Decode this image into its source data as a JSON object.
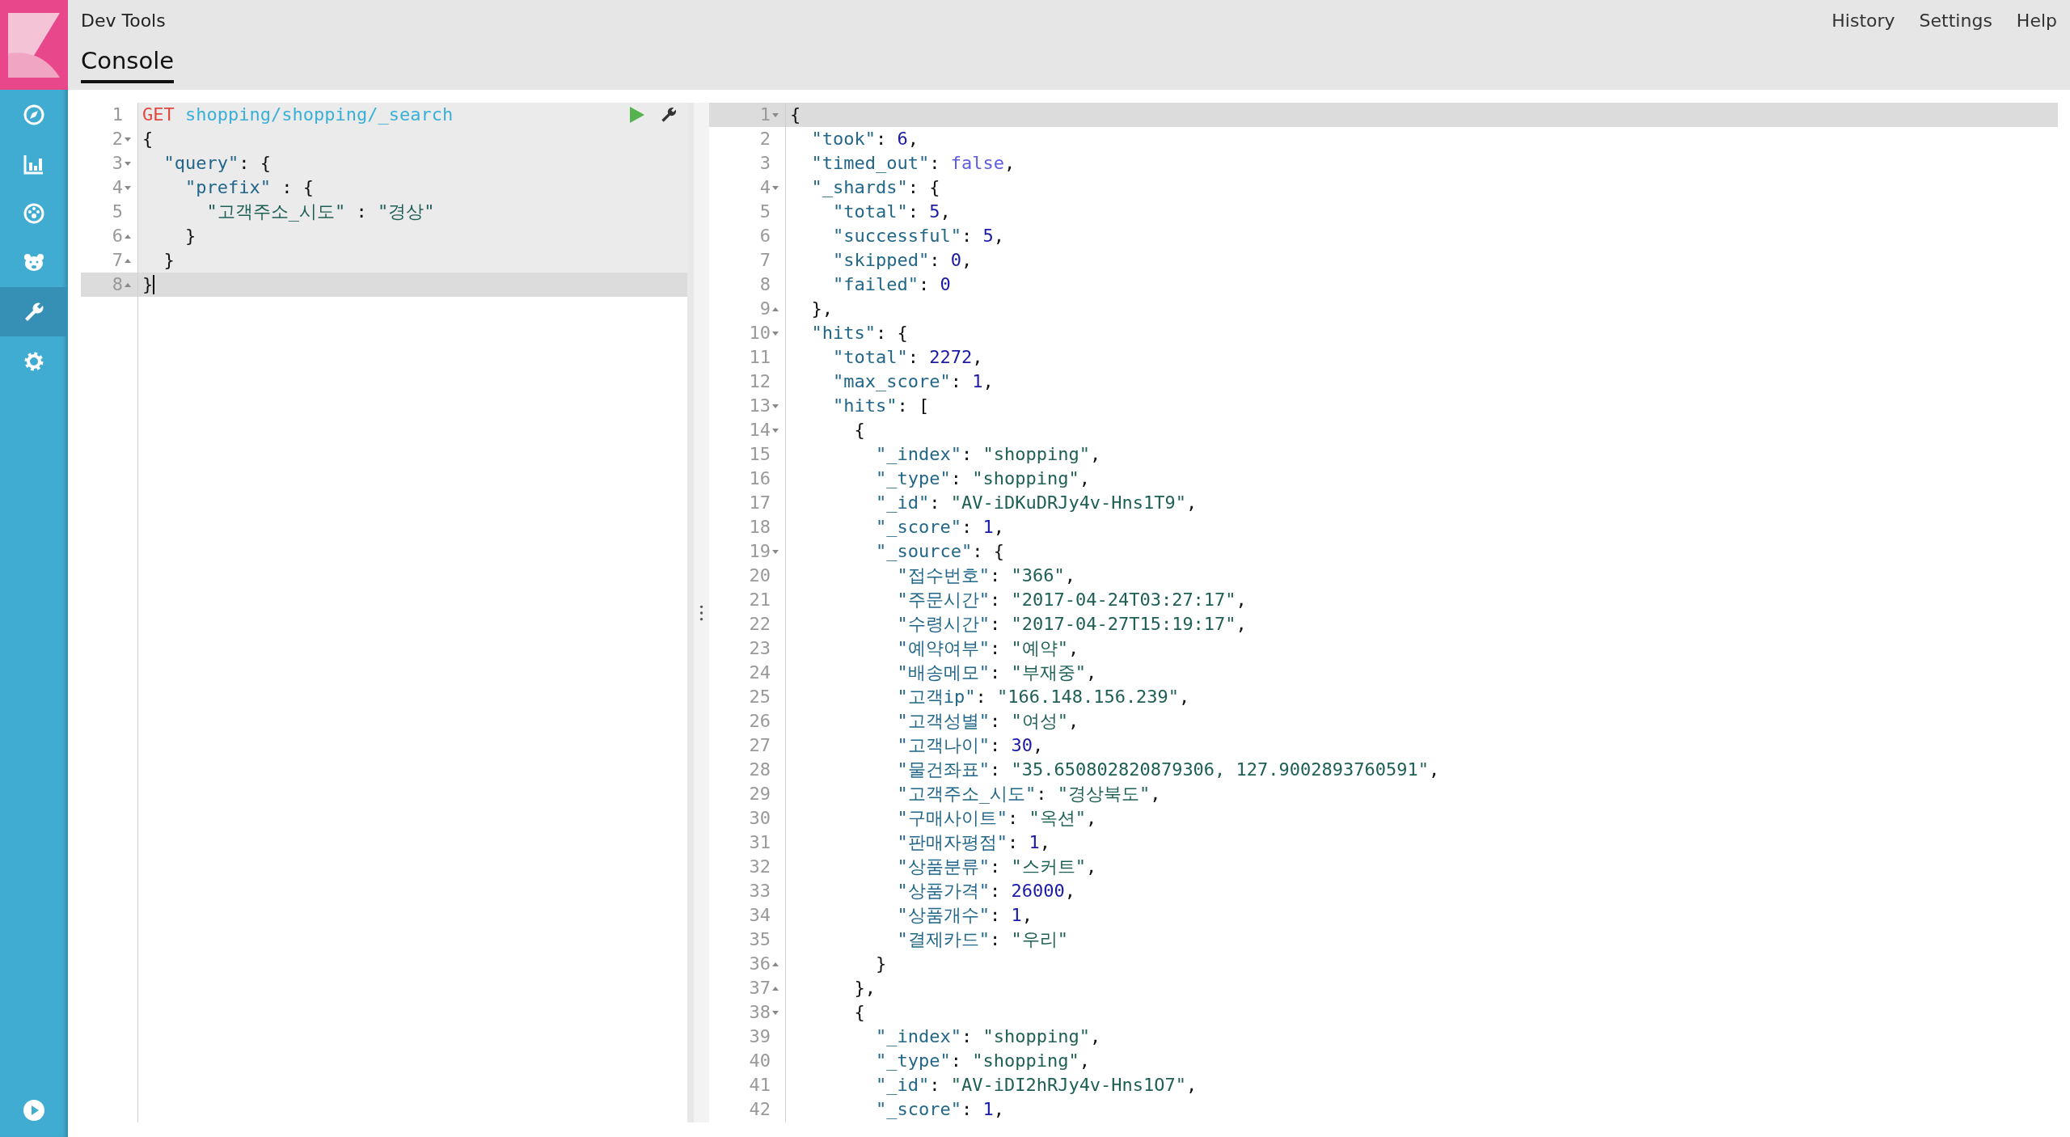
{
  "header": {
    "title": "Dev Tools",
    "menu": [
      "History",
      "Settings",
      "Help"
    ]
  },
  "sidebar": {
    "items": [
      {
        "kind": "compass",
        "selected": false
      },
      {
        "kind": "chart",
        "selected": false
      },
      {
        "kind": "gauge",
        "selected": false
      },
      {
        "kind": "bear",
        "selected": false
      },
      {
        "kind": "wrench",
        "selected": true
      },
      {
        "kind": "gear",
        "selected": false
      }
    ],
    "footer": {
      "kind": "play"
    }
  },
  "tabs": [
    {
      "label": "Console",
      "selected": true
    }
  ],
  "request": {
    "lines": [
      {
        "number": "1",
        "kind": "plain",
        "highlighted": true,
        "active": false,
        "cursor": false,
        "tokens": [
          {
            "kind": "method",
            "text": "GET"
          },
          {
            "kind": "url",
            "text": " shopping/shopping/_search"
          }
        ]
      },
      {
        "number": "2",
        "kind": "open",
        "highlighted": true,
        "active": false,
        "cursor": false,
        "tokens": [
          {
            "kind": "p",
            "text": "{"
          }
        ]
      },
      {
        "number": "3",
        "kind": "open",
        "highlighted": true,
        "active": false,
        "cursor": false,
        "tokens": [
          {
            "kind": "key",
            "text": "  \"query\""
          },
          {
            "kind": "p",
            "text": ": {"
          }
        ]
      },
      {
        "number": "4",
        "kind": "open",
        "highlighted": true,
        "active": false,
        "cursor": false,
        "tokens": [
          {
            "kind": "key",
            "text": "    \"prefix\""
          },
          {
            "kind": "p",
            "text": " : {"
          }
        ]
      },
      {
        "number": "5",
        "kind": "plain",
        "highlighted": true,
        "active": false,
        "cursor": false,
        "tokens": [
          {
            "kind": "str",
            "text": "      \"고객주소_시도\""
          },
          {
            "kind": "p",
            "text": " : "
          },
          {
            "kind": "str",
            "text": "\"경상\""
          }
        ]
      },
      {
        "number": "6",
        "kind": "close",
        "highlighted": true,
        "active": false,
        "cursor": false,
        "tokens": [
          {
            "kind": "p",
            "text": "    }"
          }
        ]
      },
      {
        "number": "7",
        "kind": "close",
        "highlighted": true,
        "active": false,
        "cursor": false,
        "tokens": [
          {
            "kind": "p",
            "text": "  }"
          }
        ]
      },
      {
        "number": "8",
        "kind": "close",
        "highlighted": true,
        "active": true,
        "cursor": true,
        "tokens": [
          {
            "kind": "p",
            "text": "}"
          }
        ]
      }
    ]
  },
  "response": {
    "lines": [
      {
        "number": "1",
        "kind": "open",
        "active": true,
        "tokens": [
          {
            "kind": "p",
            "text": "{"
          }
        ]
      },
      {
        "number": "2",
        "kind": "plain",
        "active": false,
        "tokens": [
          {
            "kind": "key",
            "text": "  \"took\""
          },
          {
            "kind": "p",
            "text": ": "
          },
          {
            "kind": "num",
            "text": "6"
          },
          {
            "kind": "p",
            "text": ","
          }
        ]
      },
      {
        "number": "3",
        "kind": "plain",
        "active": false,
        "tokens": [
          {
            "kind": "key",
            "text": "  \"timed_out\""
          },
          {
            "kind": "p",
            "text": ": "
          },
          {
            "kind": "bool",
            "text": "false"
          },
          {
            "kind": "p",
            "text": ","
          }
        ]
      },
      {
        "number": "4",
        "kind": "open",
        "active": false,
        "tokens": [
          {
            "kind": "key",
            "text": "  \"_shards\""
          },
          {
            "kind": "p",
            "text": ": {"
          }
        ]
      },
      {
        "number": "5",
        "kind": "plain",
        "active": false,
        "tokens": [
          {
            "kind": "key",
            "text": "    \"total\""
          },
          {
            "kind": "p",
            "text": ": "
          },
          {
            "kind": "num",
            "text": "5"
          },
          {
            "kind": "p",
            "text": ","
          }
        ]
      },
      {
        "number": "6",
        "kind": "plain",
        "active": false,
        "tokens": [
          {
            "kind": "key",
            "text": "    \"successful\""
          },
          {
            "kind": "p",
            "text": ": "
          },
          {
            "kind": "num",
            "text": "5"
          },
          {
            "kind": "p",
            "text": ","
          }
        ]
      },
      {
        "number": "7",
        "kind": "plain",
        "active": false,
        "tokens": [
          {
            "kind": "key",
            "text": "    \"skipped\""
          },
          {
            "kind": "p",
            "text": ": "
          },
          {
            "kind": "num",
            "text": "0"
          },
          {
            "kind": "p",
            "text": ","
          }
        ]
      },
      {
        "number": "8",
        "kind": "plain",
        "active": false,
        "tokens": [
          {
            "kind": "key",
            "text": "    \"failed\""
          },
          {
            "kind": "p",
            "text": ": "
          },
          {
            "kind": "num",
            "text": "0"
          }
        ]
      },
      {
        "number": "9",
        "kind": "close",
        "active": false,
        "tokens": [
          {
            "kind": "p",
            "text": "  },"
          }
        ]
      },
      {
        "number": "10",
        "kind": "open",
        "active": false,
        "tokens": [
          {
            "kind": "key",
            "text": "  \"hits\""
          },
          {
            "kind": "p",
            "text": ": {"
          }
        ]
      },
      {
        "number": "11",
        "kind": "plain",
        "active": false,
        "tokens": [
          {
            "kind": "key",
            "text": "    \"total\""
          },
          {
            "kind": "p",
            "text": ": "
          },
          {
            "kind": "num",
            "text": "2272"
          },
          {
            "kind": "p",
            "text": ","
          }
        ]
      },
      {
        "number": "12",
        "kind": "plain",
        "active": false,
        "tokens": [
          {
            "kind": "key",
            "text": "    \"max_score\""
          },
          {
            "kind": "p",
            "text": ": "
          },
          {
            "kind": "num",
            "text": "1"
          },
          {
            "kind": "p",
            "text": ","
          }
        ]
      },
      {
        "number": "13",
        "kind": "open",
        "active": false,
        "tokens": [
          {
            "kind": "key",
            "text": "    \"hits\""
          },
          {
            "kind": "p",
            "text": ": ["
          }
        ]
      },
      {
        "number": "14",
        "kind": "open",
        "active": false,
        "tokens": [
          {
            "kind": "p",
            "text": "      {"
          }
        ]
      },
      {
        "number": "15",
        "kind": "plain",
        "active": false,
        "tokens": [
          {
            "kind": "key",
            "text": "        \"_index\""
          },
          {
            "kind": "p",
            "text": ": "
          },
          {
            "kind": "str",
            "text": "\"shopping\""
          },
          {
            "kind": "p",
            "text": ","
          }
        ]
      },
      {
        "number": "16",
        "kind": "plain",
        "active": false,
        "tokens": [
          {
            "kind": "key",
            "text": "        \"_type\""
          },
          {
            "kind": "p",
            "text": ": "
          },
          {
            "kind": "str",
            "text": "\"shopping\""
          },
          {
            "kind": "p",
            "text": ","
          }
        ]
      },
      {
        "number": "17",
        "kind": "plain",
        "active": false,
        "tokens": [
          {
            "kind": "key",
            "text": "        \"_id\""
          },
          {
            "kind": "p",
            "text": ": "
          },
          {
            "kind": "str",
            "text": "\"AV-iDKuDRJy4v-Hns1T9\""
          },
          {
            "kind": "p",
            "text": ","
          }
        ]
      },
      {
        "number": "18",
        "kind": "plain",
        "active": false,
        "tokens": [
          {
            "kind": "key",
            "text": "        \"_score\""
          },
          {
            "kind": "p",
            "text": ": "
          },
          {
            "kind": "num",
            "text": "1"
          },
          {
            "kind": "p",
            "text": ","
          }
        ]
      },
      {
        "number": "19",
        "kind": "open",
        "active": false,
        "tokens": [
          {
            "kind": "key",
            "text": "        \"_source\""
          },
          {
            "kind": "p",
            "text": ": {"
          }
        ]
      },
      {
        "number": "20",
        "kind": "plain",
        "active": false,
        "tokens": [
          {
            "kind": "key",
            "text": "          \"접수번호\""
          },
          {
            "kind": "p",
            "text": ": "
          },
          {
            "kind": "str",
            "text": "\"366\""
          },
          {
            "kind": "p",
            "text": ","
          }
        ]
      },
      {
        "number": "21",
        "kind": "plain",
        "active": false,
        "tokens": [
          {
            "kind": "key",
            "text": "          \"주문시간\""
          },
          {
            "kind": "p",
            "text": ": "
          },
          {
            "kind": "str",
            "text": "\"2017-04-24T03:27:17\""
          },
          {
            "kind": "p",
            "text": ","
          }
        ]
      },
      {
        "number": "22",
        "kind": "plain",
        "active": false,
        "tokens": [
          {
            "kind": "key",
            "text": "          \"수령시간\""
          },
          {
            "kind": "p",
            "text": ": "
          },
          {
            "kind": "str",
            "text": "\"2017-04-27T15:19:17\""
          },
          {
            "kind": "p",
            "text": ","
          }
        ]
      },
      {
        "number": "23",
        "kind": "plain",
        "active": false,
        "tokens": [
          {
            "kind": "key",
            "text": "          \"예약여부\""
          },
          {
            "kind": "p",
            "text": ": "
          },
          {
            "kind": "str",
            "text": "\"예약\""
          },
          {
            "kind": "p",
            "text": ","
          }
        ]
      },
      {
        "number": "24",
        "kind": "plain",
        "active": false,
        "tokens": [
          {
            "kind": "key",
            "text": "          \"배송메모\""
          },
          {
            "kind": "p",
            "text": ": "
          },
          {
            "kind": "str",
            "text": "\"부재중\""
          },
          {
            "kind": "p",
            "text": ","
          }
        ]
      },
      {
        "number": "25",
        "kind": "plain",
        "active": false,
        "tokens": [
          {
            "kind": "key",
            "text": "          \"고객ip\""
          },
          {
            "kind": "p",
            "text": ": "
          },
          {
            "kind": "str",
            "text": "\"166.148.156.239\""
          },
          {
            "kind": "p",
            "text": ","
          }
        ]
      },
      {
        "number": "26",
        "kind": "plain",
        "active": false,
        "tokens": [
          {
            "kind": "key",
            "text": "          \"고객성별\""
          },
          {
            "kind": "p",
            "text": ": "
          },
          {
            "kind": "str",
            "text": "\"여성\""
          },
          {
            "kind": "p",
            "text": ","
          }
        ]
      },
      {
        "number": "27",
        "kind": "plain",
        "active": false,
        "tokens": [
          {
            "kind": "key",
            "text": "          \"고객나이\""
          },
          {
            "kind": "p",
            "text": ": "
          },
          {
            "kind": "num",
            "text": "30"
          },
          {
            "kind": "p",
            "text": ","
          }
        ]
      },
      {
        "number": "28",
        "kind": "plain",
        "active": false,
        "tokens": [
          {
            "kind": "key",
            "text": "          \"물건좌표\""
          },
          {
            "kind": "p",
            "text": ": "
          },
          {
            "kind": "str",
            "text": "\"35.650802820879306, 127.9002893760591\""
          },
          {
            "kind": "p",
            "text": ","
          }
        ]
      },
      {
        "number": "29",
        "kind": "plain",
        "active": false,
        "tokens": [
          {
            "kind": "key",
            "text": "          \"고객주소_시도\""
          },
          {
            "kind": "p",
            "text": ": "
          },
          {
            "kind": "str",
            "text": "\"경상북도\""
          },
          {
            "kind": "p",
            "text": ","
          }
        ]
      },
      {
        "number": "30",
        "kind": "plain",
        "active": false,
        "tokens": [
          {
            "kind": "key",
            "text": "          \"구매사이트\""
          },
          {
            "kind": "p",
            "text": ": "
          },
          {
            "kind": "str",
            "text": "\"옥션\""
          },
          {
            "kind": "p",
            "text": ","
          }
        ]
      },
      {
        "number": "31",
        "kind": "plain",
        "active": false,
        "tokens": [
          {
            "kind": "key",
            "text": "          \"판매자평점\""
          },
          {
            "kind": "p",
            "text": ": "
          },
          {
            "kind": "num",
            "text": "1"
          },
          {
            "kind": "p",
            "text": ","
          }
        ]
      },
      {
        "number": "32",
        "kind": "plain",
        "active": false,
        "tokens": [
          {
            "kind": "key",
            "text": "          \"상품분류\""
          },
          {
            "kind": "p",
            "text": ": "
          },
          {
            "kind": "str",
            "text": "\"스커트\""
          },
          {
            "kind": "p",
            "text": ","
          }
        ]
      },
      {
        "number": "33",
        "kind": "plain",
        "active": false,
        "tokens": [
          {
            "kind": "key",
            "text": "          \"상품가격\""
          },
          {
            "kind": "p",
            "text": ": "
          },
          {
            "kind": "num",
            "text": "26000"
          },
          {
            "kind": "p",
            "text": ","
          }
        ]
      },
      {
        "number": "34",
        "kind": "plain",
        "active": false,
        "tokens": [
          {
            "kind": "key",
            "text": "          \"상품개수\""
          },
          {
            "kind": "p",
            "text": ": "
          },
          {
            "kind": "num",
            "text": "1"
          },
          {
            "kind": "p",
            "text": ","
          }
        ]
      },
      {
        "number": "35",
        "kind": "plain",
        "active": false,
        "tokens": [
          {
            "kind": "key",
            "text": "          \"결제카드\""
          },
          {
            "kind": "p",
            "text": ": "
          },
          {
            "kind": "str",
            "text": "\"우리\""
          }
        ]
      },
      {
        "number": "36",
        "kind": "close",
        "active": false,
        "tokens": [
          {
            "kind": "p",
            "text": "        }"
          }
        ]
      },
      {
        "number": "37",
        "kind": "close",
        "active": false,
        "tokens": [
          {
            "kind": "p",
            "text": "      },"
          }
        ]
      },
      {
        "number": "38",
        "kind": "open",
        "active": false,
        "tokens": [
          {
            "kind": "p",
            "text": "      {"
          }
        ]
      },
      {
        "number": "39",
        "kind": "plain",
        "active": false,
        "tokens": [
          {
            "kind": "key",
            "text": "        \"_index\""
          },
          {
            "kind": "p",
            "text": ": "
          },
          {
            "kind": "str",
            "text": "\"shopping\""
          },
          {
            "kind": "p",
            "text": ","
          }
        ]
      },
      {
        "number": "40",
        "kind": "plain",
        "active": false,
        "tokens": [
          {
            "kind": "key",
            "text": "        \"_type\""
          },
          {
            "kind": "p",
            "text": ": "
          },
          {
            "kind": "str",
            "text": "\"shopping\""
          },
          {
            "kind": "p",
            "text": ","
          }
        ]
      },
      {
        "number": "41",
        "kind": "plain",
        "active": false,
        "tokens": [
          {
            "kind": "key",
            "text": "        \"_id\""
          },
          {
            "kind": "p",
            "text": ": "
          },
          {
            "kind": "str",
            "text": "\"AV-iDI2hRJy4v-Hns1O7\""
          },
          {
            "kind": "p",
            "text": ","
          }
        ]
      },
      {
        "number": "42",
        "kind": "plain",
        "active": false,
        "tokens": [
          {
            "kind": "key",
            "text": "        \"_score\""
          },
          {
            "kind": "p",
            "text": ": "
          },
          {
            "kind": "num",
            "text": "1"
          },
          {
            "kind": "p",
            "text": ","
          }
        ]
      }
    ]
  }
}
